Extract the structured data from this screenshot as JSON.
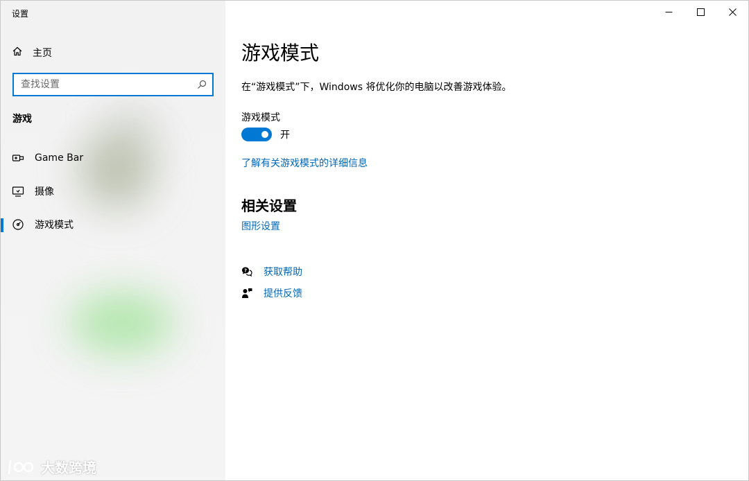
{
  "window": {
    "title": "设置",
    "controls": {
      "minimize": "minimize",
      "maximize": "maximize",
      "close": "close"
    }
  },
  "sidebar": {
    "home_label": "主页",
    "search": {
      "placeholder": "查找设置",
      "value": ""
    },
    "section_label": "游戏",
    "items": [
      {
        "label": "Game Bar",
        "icon": "game-bar-icon",
        "selected": false
      },
      {
        "label": "摄像",
        "icon": "capture-icon",
        "selected": false
      },
      {
        "label": "游戏模式",
        "icon": "game-mode-icon",
        "selected": true
      }
    ]
  },
  "main": {
    "title": "游戏模式",
    "description": "在“游戏模式”下，Windows 将优化你的电脑以改善游戏体验。",
    "toggle": {
      "label": "游戏模式",
      "state_text": "开",
      "on": true
    },
    "learn_more_link": "了解有关游戏模式的详细信息",
    "related": {
      "title": "相关设置",
      "graphics_link": "图形设置"
    },
    "help": {
      "get_help": "获取帮助",
      "feedback": "提供反馈"
    }
  },
  "watermark": {
    "text": "大数跨境"
  },
  "colors": {
    "accent": "#0078d4",
    "link": "#0067b8",
    "sidebar_bg": "#f2f2f2"
  }
}
